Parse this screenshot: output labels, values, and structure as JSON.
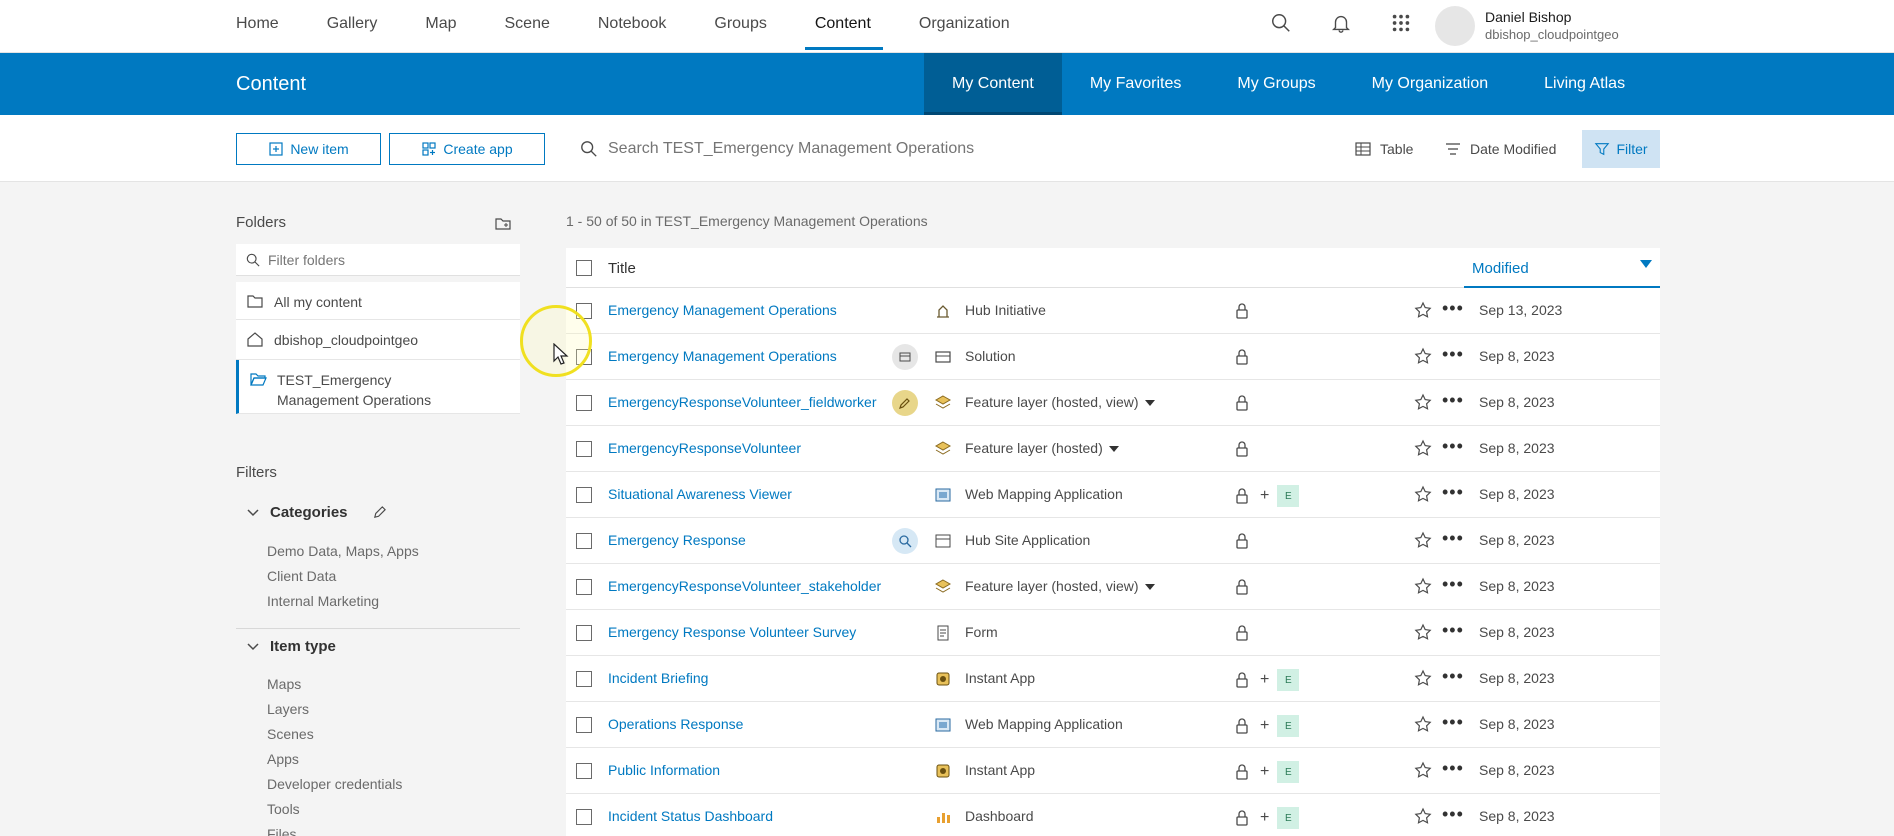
{
  "nav": {
    "links": [
      "Home",
      "Gallery",
      "Map",
      "Scene",
      "Notebook",
      "Groups",
      "Content",
      "Organization"
    ],
    "active": "Content"
  },
  "user": {
    "name": "Daniel Bishop",
    "username": "dbishop_cloudpointgeo"
  },
  "content_bar": {
    "title": "Content",
    "tabs": [
      "My Content",
      "My Favorites",
      "My Groups",
      "My Organization",
      "Living Atlas"
    ],
    "active_tab": "My Content"
  },
  "toolbar": {
    "new_item": "New item",
    "create_app": "Create app",
    "search_placeholder": "Search TEST_Emergency Management Operations",
    "view": "Table",
    "sort": "Date Modified",
    "filter": "Filter"
  },
  "sidebar": {
    "folders_title": "Folders",
    "filter_folders_placeholder": "Filter folders",
    "folders": [
      {
        "label": "All my content",
        "icon": "folder-icon"
      },
      {
        "label": "dbishop_cloudpointgeo",
        "icon": "home-icon"
      },
      {
        "label": "TEST_Emergency Management Operations",
        "icon": "folder-open-icon",
        "active": true
      }
    ],
    "filters_title": "Filters",
    "categories": {
      "title": "Categories",
      "items": [
        "Demo Data, Maps, Apps",
        "Client Data",
        "Internal Marketing"
      ]
    },
    "item_type": {
      "title": "Item type",
      "items": [
        "Maps",
        "Layers",
        "Scenes",
        "Apps",
        "Developer credentials",
        "Tools",
        "Files"
      ]
    }
  },
  "list": {
    "count_text": "1 - 50 of 50 in TEST_Emergency Management Operations",
    "col_title": "Title",
    "col_modified": "Modified",
    "rows": [
      {
        "title": "Emergency Management Operations",
        "type": "Hub Initiative",
        "dropdown": false,
        "shared_extra": false,
        "date": "Sep 13, 2023",
        "badge": ""
      },
      {
        "title": "Emergency Management Operations",
        "type": "Solution",
        "dropdown": false,
        "shared_extra": false,
        "date": "Sep 8, 2023",
        "badge": "solution"
      },
      {
        "title": "EmergencyResponseVolunteer_fieldworker",
        "type": "Feature layer (hosted, view)",
        "dropdown": true,
        "shared_extra": false,
        "date": "Sep 8, 2023",
        "badge": "edit"
      },
      {
        "title": "EmergencyResponseVolunteer",
        "type": "Feature layer (hosted)",
        "dropdown": true,
        "shared_extra": false,
        "date": "Sep 8, 2023",
        "badge": ""
      },
      {
        "title": "Situational Awareness Viewer",
        "type": "Web Mapping Application",
        "dropdown": false,
        "shared_extra": true,
        "date": "Sep 8, 2023",
        "badge": ""
      },
      {
        "title": "Emergency Response",
        "type": "Hub Site Application",
        "dropdown": false,
        "shared_extra": false,
        "date": "Sep 8, 2023",
        "badge": "search"
      },
      {
        "title": "EmergencyResponseVolunteer_stakeholder",
        "type": "Feature layer (hosted, view)",
        "dropdown": true,
        "shared_extra": false,
        "date": "Sep 8, 2023",
        "badge": ""
      },
      {
        "title": "Emergency Response Volunteer Survey",
        "type": "Form",
        "dropdown": false,
        "shared_extra": false,
        "date": "Sep 8, 2023",
        "badge": ""
      },
      {
        "title": "Incident Briefing",
        "type": "Instant App",
        "dropdown": false,
        "shared_extra": true,
        "date": "Sep 8, 2023",
        "badge": ""
      },
      {
        "title": "Operations Response",
        "type": "Web Mapping Application",
        "dropdown": false,
        "shared_extra": true,
        "date": "Sep 8, 2023",
        "badge": ""
      },
      {
        "title": "Public Information",
        "type": "Instant App",
        "dropdown": false,
        "shared_extra": true,
        "date": "Sep 8, 2023",
        "badge": ""
      },
      {
        "title": "Incident Status Dashboard",
        "type": "Dashboard",
        "dropdown": false,
        "shared_extra": true,
        "date": "Sep 8, 2023",
        "badge": ""
      }
    ],
    "share_extra_label": "E"
  },
  "colors": {
    "accent": "#0079c1",
    "accent_dark": "#005e95",
    "badge_green": "#d1f0e4"
  }
}
